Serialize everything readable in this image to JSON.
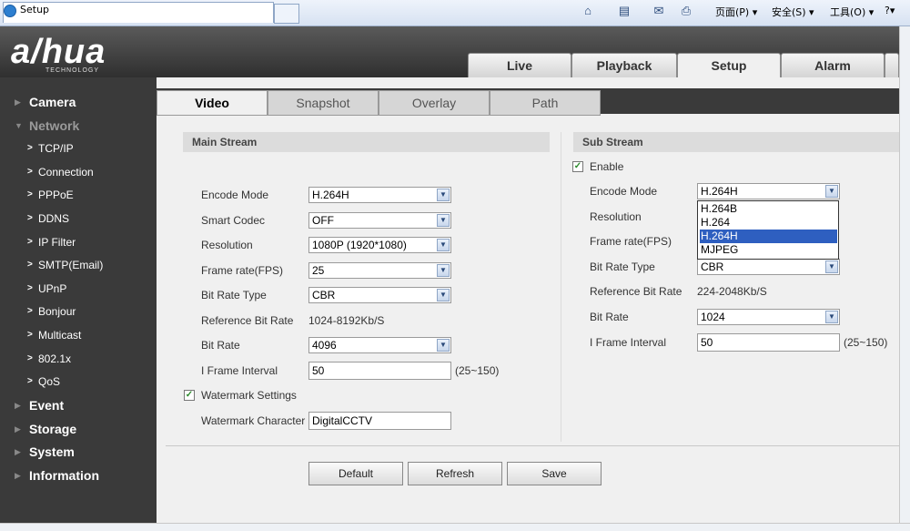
{
  "browser": {
    "tab_title": "Setup",
    "toolbar": {
      "page": "页面(P) ▾",
      "safety": "安全(S) ▾",
      "tools": "工具(O) ▾",
      "help": "?▾"
    }
  },
  "app": {
    "logo": "a/hua",
    "logo_sub": "TECHNOLOGY",
    "main_tabs": [
      {
        "label": "Live"
      },
      {
        "label": "Playback"
      },
      {
        "label": "Setup"
      },
      {
        "label": "Alarm"
      }
    ],
    "sidebar": {
      "camera": "Camera",
      "network": "Network",
      "network_items": [
        "TCP/IP",
        "Connection",
        "PPPoE",
        "DDNS",
        "IP Filter",
        "SMTP(Email)",
        "UPnP",
        "Bonjour",
        "Multicast",
        "802.1x",
        "QoS"
      ],
      "event": "Event",
      "storage": "Storage",
      "system": "System",
      "information": "Information"
    },
    "sub_tabs": [
      {
        "label": "Video"
      },
      {
        "label": "Snapshot"
      },
      {
        "label": "Overlay"
      },
      {
        "label": "Path"
      }
    ]
  },
  "main_stream": {
    "title": "Main Stream",
    "encode_mode": {
      "label": "Encode Mode",
      "value": "H.264H"
    },
    "smart_codec": {
      "label": "Smart Codec",
      "value": "OFF"
    },
    "resolution": {
      "label": "Resolution",
      "value": "1080P (1920*1080)"
    },
    "frame_rate": {
      "label": "Frame rate(FPS)",
      "value": "25"
    },
    "bit_rate_type": {
      "label": "Bit Rate Type",
      "value": "CBR"
    },
    "reference_bit_rate": {
      "label": "Reference Bit Rate",
      "value": "1024-8192Kb/S"
    },
    "bit_rate": {
      "label": "Bit Rate",
      "value": "4096"
    },
    "i_frame_interval": {
      "label": "I Frame Interval",
      "value": "50",
      "hint": "(25~150)"
    },
    "watermark_settings": {
      "label": "Watermark Settings",
      "checked": true
    },
    "watermark_character": {
      "label": "Watermark Character",
      "value": "DigitalCCTV"
    }
  },
  "sub_stream": {
    "title": "Sub Stream",
    "enable": {
      "label": "Enable",
      "checked": true
    },
    "encode_mode": {
      "label": "Encode Mode",
      "value": "H.264H",
      "options": [
        "H.264B",
        "H.264",
        "H.264H",
        "MJPEG"
      ]
    },
    "resolution": {
      "label": "Resolution"
    },
    "frame_rate": {
      "label": "Frame rate(FPS)"
    },
    "bit_rate_type": {
      "label": "Bit Rate Type",
      "value": "CBR"
    },
    "reference_bit_rate": {
      "label": "Reference Bit Rate",
      "value": "224-2048Kb/S"
    },
    "bit_rate": {
      "label": "Bit Rate",
      "value": "1024"
    },
    "i_frame_interval": {
      "label": "I Frame Interval",
      "value": "50",
      "hint": "(25~150)"
    }
  },
  "buttons": {
    "default": "Default",
    "refresh": "Refresh",
    "save": "Save"
  }
}
